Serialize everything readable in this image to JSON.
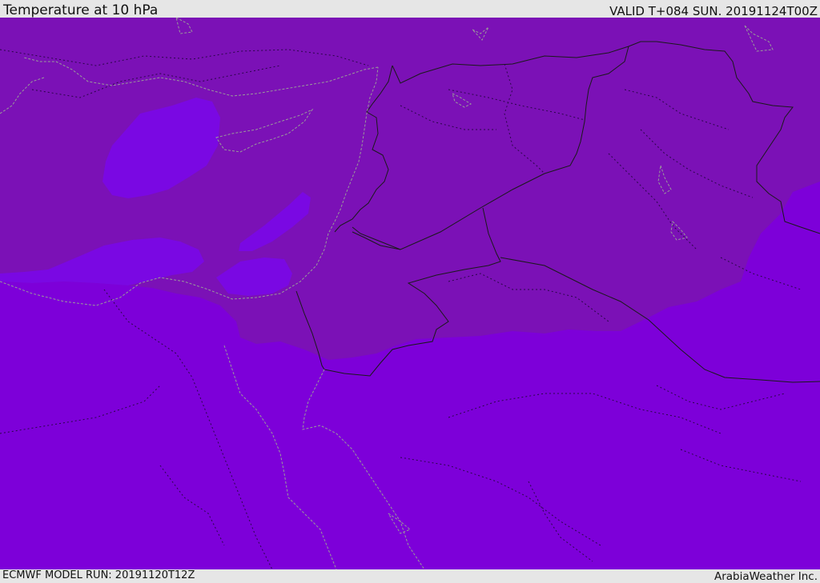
{
  "header": {
    "title": "Temperature at 10 hPa",
    "valid_time": "VALID T+084 SUN. 20191124T00Z"
  },
  "footer": {
    "model_run": "ECMWF MODEL RUN: 20191120T12Z",
    "credit": "ArabiaWeather Inc."
  },
  "map": {
    "colors": {
      "warm_band": "#7b11b6",
      "cool_band": "#7d00d9",
      "mid_band": "#7a08e3",
      "land_border": "#1a1a1a",
      "coast": "#9a9a9a",
      "province": "#3a0a5a"
    }
  }
}
